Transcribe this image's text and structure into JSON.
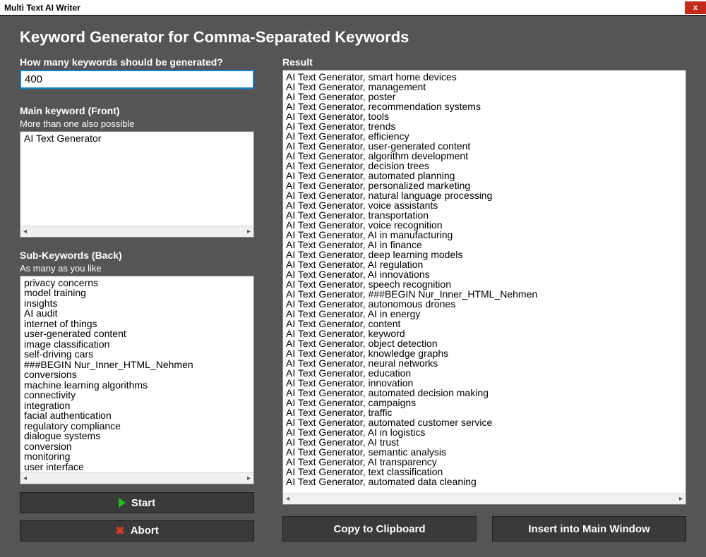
{
  "window": {
    "title": "Multi Text AI Writer",
    "close": "x"
  },
  "heading": "Keyword Generator for Comma-Separated Keywords",
  "left": {
    "count_label": "How many keywords should be generated?",
    "count_value": "400",
    "main_kw_label": "Main keyword (Front)",
    "main_kw_sub": "More than one also possible",
    "main_kw_value": "AI Text Generator",
    "sub_kw_label": "Sub-Keywords (Back)",
    "sub_kw_sub": "As many as you like",
    "sub_kw_lines": [
      "privacy concerns",
      "model training",
      "insights",
      "AI audit",
      "internet of things",
      "user-generated content",
      "image classification",
      "self-driving cars",
      "###BEGIN Nur_Inner_HTML_Nehmen",
      "conversions",
      "machine learning algorithms",
      "connectivity",
      "integration",
      "facial authentication",
      "regulatory compliance",
      "dialogue systems",
      "conversion",
      "monitoring",
      "user interface"
    ],
    "start_label": "Start",
    "abort_label": "Abort"
  },
  "right": {
    "result_label": "Result",
    "result_lines": [
      "AI Text Generator, smart home devices",
      "AI Text Generator, management",
      "AI Text Generator, poster",
      "AI Text Generator, recommendation systems",
      "AI Text Generator, tools",
      "AI Text Generator, trends",
      "AI Text Generator, efficiency",
      "AI Text Generator, user-generated content",
      "AI Text Generator, algorithm development",
      "AI Text Generator, decision trees",
      "AI Text Generator, automated planning",
      "AI Text Generator, personalized marketing",
      "AI Text Generator, natural language processing",
      "AI Text Generator, voice assistants",
      "AI Text Generator, transportation",
      "AI Text Generator, voice recognition",
      "AI Text Generator, AI in manufacturing",
      "AI Text Generator, AI in finance",
      "AI Text Generator, deep learning models",
      "AI Text Generator, AI regulation",
      "AI Text Generator, AI innovations",
      "AI Text Generator, speech recognition",
      "AI Text Generator, ###BEGIN Nur_Inner_HTML_Nehmen",
      "AI Text Generator, autonomous drones",
      "AI Text Generator, AI in energy",
      "AI Text Generator, content",
      "AI Text Generator, keyword",
      "AI Text Generator, object detection",
      "AI Text Generator, knowledge graphs",
      "AI Text Generator, neural networks",
      "AI Text Generator, education",
      "AI Text Generator, innovation",
      "AI Text Generator, automated decision making",
      "AI Text Generator, campaigns",
      "AI Text Generator, traffic",
      "AI Text Generator, automated customer service",
      "AI Text Generator, AI in logistics",
      "AI Text Generator, AI trust",
      "AI Text Generator, semantic analysis",
      "AI Text Generator, AI transparency",
      "AI Text Generator, text classification",
      "AI Text Generator, automated data cleaning"
    ],
    "copy_label": "Copy to Clipboard",
    "insert_label": "Insert into Main Window"
  }
}
